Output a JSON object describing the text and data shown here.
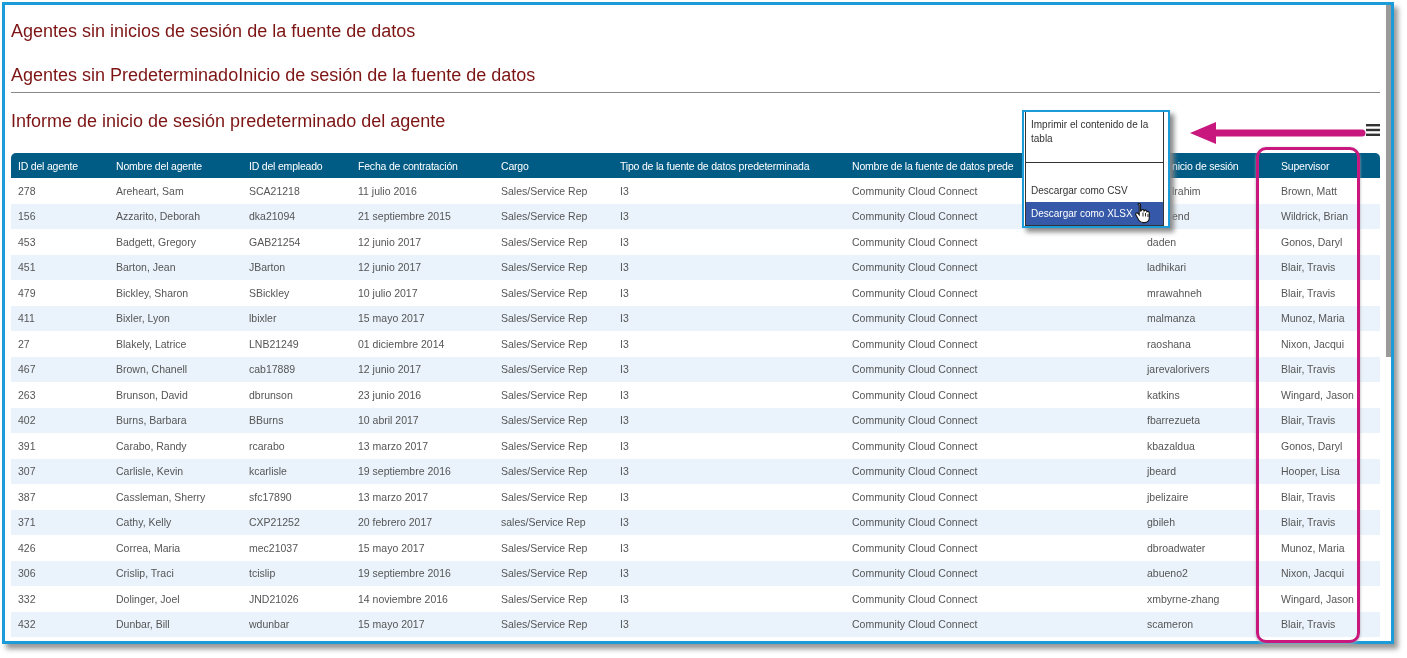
{
  "headings": [
    "Agentes sin inicios de sesión de la fuente de datos",
    "Agentes sin PredeterminadoInicio de sesión de la fuente de datos",
    "Informe de inicio de sesión predeterminado del agente"
  ],
  "table": {
    "columns": [
      "ID del agente",
      "Nombre del agente",
      "ID del empleado",
      "Fecha de contratación",
      "Cargo",
      "Tipo de la fuente de datos predeterminada",
      "Nombre de la fuente de datos prede",
      "nicio de sesión",
      "Supervisor"
    ],
    "rows": [
      [
        "278",
        "Areheart, Sam",
        "SCA21218",
        "11 julio 2016",
        "Sales/Service Rep",
        "I3",
        "Community Cloud Connect",
        "lrahim",
        "Brown, Matt"
      ],
      [
        "156",
        "Azzarito, Deborah",
        "dka21094",
        "21 septiembre 2015",
        "Sales/Service Rep",
        "I3",
        "Community Cloud Connect",
        "end",
        "Wildrick, Brian"
      ],
      [
        "453",
        "Badgett, Gregory",
        "GAB21254",
        "12 junio 2017",
        "Sales/Service Rep",
        "I3",
        "Community Cloud Connect",
        "daden",
        "Gonos, Daryl"
      ],
      [
        "451",
        "Barton, Jean",
        "JBarton",
        "12 junio 2017",
        "Sales/Service Rep",
        "I3",
        "Community Cloud Connect",
        "ladhikari",
        "Blair, Travis"
      ],
      [
        "479",
        "Bickley, Sharon",
        "SBickley",
        "10 julio 2017",
        "Sales/Service Rep",
        "I3",
        "Community Cloud Connect",
        "mrawahneh",
        "Blair, Travis"
      ],
      [
        "411",
        "Bixler, Lyon",
        "lbixler",
        "15 mayo 2017",
        "Sales/Service Rep",
        "I3",
        "Community Cloud Connect",
        "malmanza",
        "Munoz, Maria"
      ],
      [
        "27",
        "Blakely, Latrice",
        "LNB21249",
        "01 diciembre 2014",
        "Sales/Service Rep",
        "I3",
        "Community Cloud Connect",
        "raoshana",
        "Nixon, Jacqui"
      ],
      [
        "467",
        "Brown, Chanell",
        "cab17889",
        "12 junio 2017",
        "Sales/Service Rep",
        "I3",
        "Community Cloud Connect",
        "jarevalorivers",
        "Blair, Travis"
      ],
      [
        "263",
        "Brunson, David",
        "dbrunson",
        "23 junio 2016",
        "Sales/Service Rep",
        "I3",
        "Community Cloud Connect",
        "katkins",
        "Wingard, Jason"
      ],
      [
        "402",
        "Burns, Barbara",
        "BBurns",
        "10 abril 2017",
        "Sales/Service Rep",
        "I3",
        "Community Cloud Connect",
        "fbarrezueta",
        "Blair, Travis"
      ],
      [
        "391",
        "Carabo, Randy",
        "rcarabo",
        "13 marzo 2017",
        "Sales/Service Rep",
        "I3",
        "Community Cloud Connect",
        "kbazaldua",
        "Gonos, Daryl"
      ],
      [
        "307",
        "Carlisle, Kevin",
        "kcarlisle",
        "19 septiembre 2016",
        "Sales/Service Rep",
        "I3",
        "Community Cloud Connect",
        "jbeard",
        "Hooper, Lisa"
      ],
      [
        "387",
        "Cassleman, Sherry",
        "sfc17890",
        "13 marzo 2017",
        "Sales/Service Rep",
        "I3",
        "Community Cloud Connect",
        "jbelizaire",
        "Blair, Travis"
      ],
      [
        "371",
        "Cathy, Kelly",
        "CXP21252",
        "20 febrero 2017",
        "sales/Service Rep",
        "I3",
        "Community Cloud Connect",
        "gbileh",
        "Blair, Travis"
      ],
      [
        "426",
        "Correa, Maria",
        "mec21037",
        "15 mayo 2017",
        "Sales/Service Rep",
        "I3",
        "Community Cloud Connect",
        "dbroadwater",
        "Munoz, Maria"
      ],
      [
        "306",
        "Crislip, Traci",
        "tcislip",
        "19 septiembre 2016",
        "Sales/Service Rep",
        "I3",
        "Community Cloud Connect",
        "abueno2",
        "Nixon, Jacqui"
      ],
      [
        "332",
        "Dolinger, Joel",
        "JND21026",
        "14 noviembre 2016",
        "Sales/Service Rep",
        "I3",
        "Community Cloud Connect",
        "xmbyrne-zhang",
        "Wingard, Jason"
      ],
      [
        "432",
        "Dunbar, Bill",
        "wdunbar",
        "15 mayo 2017",
        "Sales/Service Rep",
        "I3",
        "Community Cloud Connect",
        "scameron",
        "Blair, Travis"
      ]
    ]
  },
  "menu": {
    "items": [
      {
        "kind": "item",
        "label": "Imprimir el contenido de la tabla",
        "selected": false
      },
      {
        "kind": "separator"
      },
      {
        "kind": "item",
        "label": "Descargar como CSV",
        "selected": false
      },
      {
        "kind": "item",
        "label": "Descargar como XLSX",
        "selected": true
      }
    ]
  }
}
